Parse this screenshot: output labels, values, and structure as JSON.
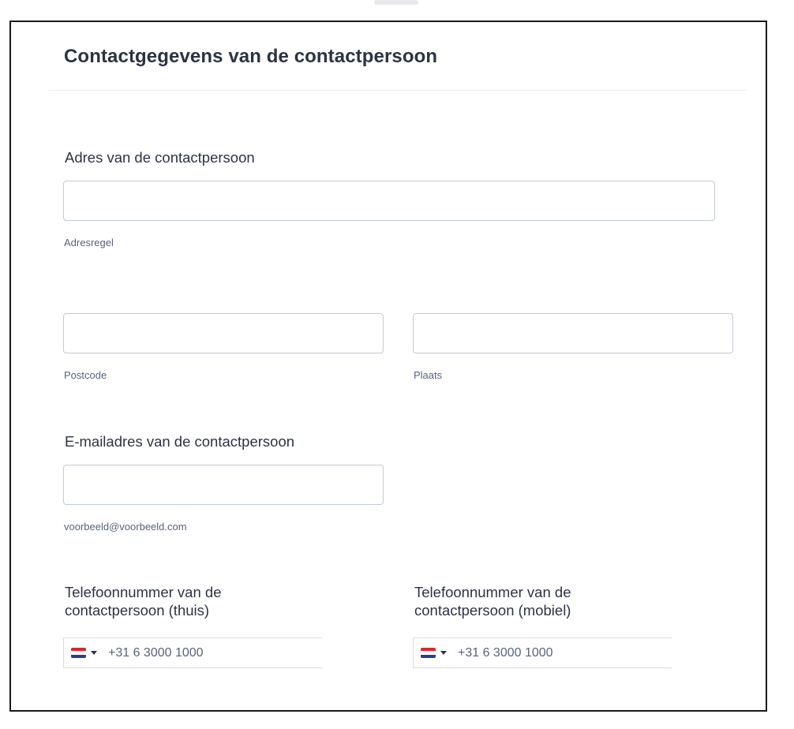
{
  "header": {
    "title": "Contactgegevens van de contactpersoon"
  },
  "address": {
    "label": "Adres van de contactpersoon",
    "line": {
      "value": "",
      "sublabel": "Adresregel"
    },
    "postcode": {
      "value": "",
      "sublabel": "Postcode"
    },
    "city": {
      "value": "",
      "sublabel": "Plaats"
    }
  },
  "email": {
    "label": "E-mailadres van de contactpersoon",
    "value": "",
    "sublabel": "voorbeeld@voorbeeld.com"
  },
  "phone_home": {
    "label_line1": "Telefoonnummer van de",
    "label_line2": "contactpersoon (thuis)",
    "country": "NL",
    "placeholder": "+31 6 3000 1000"
  },
  "phone_mobile": {
    "label_line1": "Telefoonnummer van de",
    "label_line2": "contactpersoon (mobiel)",
    "country": "NL",
    "placeholder": "+31 6 3000 1000"
  },
  "icons": {
    "flag": "netherlands-flag-icon",
    "caret": "caret-down-icon"
  },
  "colors": {
    "text": "#2c3345",
    "sublabel": "#57647e",
    "input_border": "#c3cad8",
    "frame_border": "#1a1a1a",
    "flag_red": "#d7292f",
    "flag_blue": "#243f93"
  }
}
